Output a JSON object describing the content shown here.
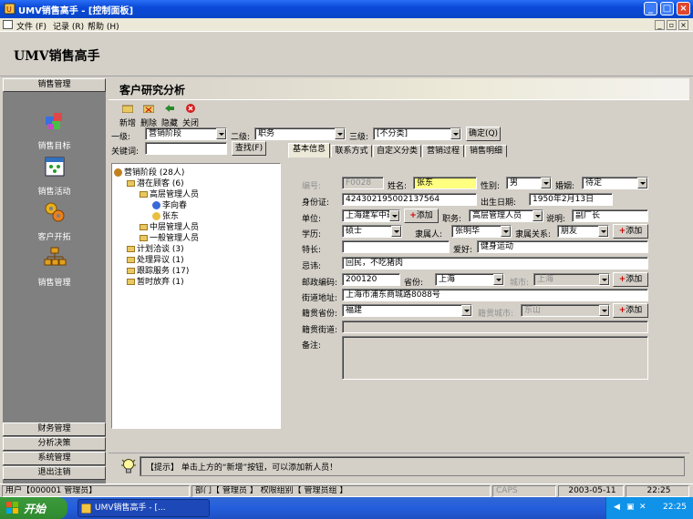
{
  "window": {
    "title": "UMV销售高手 - [控制面板]"
  },
  "menu": [
    "文件 (F)",
    "记录 (R)",
    "帮助 (H)"
  ],
  "header": {
    "app_title": "UMV销售高手"
  },
  "nav": {
    "top_section": "销售管理",
    "tiles": [
      "销售目标",
      "销售活动",
      "客户开拓",
      "销售管理"
    ],
    "bottom_sections": [
      "财务管理",
      "分析决策",
      "系统管理",
      "退出注销"
    ]
  },
  "page": {
    "title": "客户研究分析",
    "toolbar": [
      "新增",
      "删除",
      "隐藏",
      "关闭"
    ]
  },
  "filters": {
    "level1_label": "一级:",
    "level1_value": "营销阶段",
    "level2_label": "二级:",
    "level2_value": "职务",
    "level3_label": "三级:",
    "level3_value": "[不分类]",
    "confirm_label": "确定",
    "confirm_key": "(Q)",
    "keyword_label": "关键词:",
    "keyword_value": "",
    "search_label": "查找",
    "search_key": "(F)"
  },
  "tabs": [
    "基本信息",
    "联系方式",
    "自定义分类",
    "营销过程",
    "销售明细"
  ],
  "tree": [
    "营销阶段 (28人)",
    "潜在顾客 (6)",
    "高层管理人员",
    "李向春",
    "张东",
    "中层管理人员",
    "一般管理人员",
    "计划洽谈 (3)",
    "处理异议 (1)",
    "跟踪服务 (17)",
    "暂时放弃 (1)"
  ],
  "form": {
    "id_label": "编号:",
    "id_value": "F0028",
    "name_label": "姓名:",
    "name_value": "张东",
    "gender_label": "性别:",
    "gender_value": "男",
    "marital_label": "婚姻:",
    "marital_value": "待定",
    "idcard_label": "身份证:",
    "idcard_value": "424302195002137564",
    "birth_label": "出生日期:",
    "birth_value": "1950年2月13日",
    "company_label": "单位:",
    "company_value": "上海建军中药",
    "add_label": "添加",
    "title_label": "职务:",
    "title_value": "高层管理人员",
    "desc_label": "说明:",
    "desc_value": "副厂长",
    "edu_label": "学历:",
    "edu_value": "硕士",
    "owner_label": "隶属人:",
    "owner_value": "张明华",
    "relation_label": "隶属关系:",
    "relation_value": "朋友",
    "skill_label": "特长:",
    "skill_value": "",
    "hobby_label": "爱好:",
    "hobby_value": "健身运动",
    "taboo_label": "忌讳:",
    "taboo_value": "回民，不吃猪肉",
    "zip_label": "邮政编码:",
    "zip_value": "200120",
    "province_label": "省份:",
    "province_value": "上海",
    "city_label": "城市:",
    "city_value": "上海",
    "street_label": "街道地址:",
    "street_value": "上海市浦东商城路8088号",
    "native_prov_label": "籍贯省份:",
    "native_prov_value": "福建",
    "native_city_label": "籍贯城市:",
    "native_city_value": "东山",
    "native_street_label": "籍贯街道:",
    "native_street_value": "",
    "note_label": "备注:",
    "note_value": ""
  },
  "tip": {
    "text": "【提示】 单击上方的“新增”按钮，可以添加新人员！"
  },
  "status": {
    "user": "用户【000001 管理员】",
    "dept": "部门【 管理员 】 权限组别【 管理员组 】",
    "caps": "CAPS",
    "date": "2003-05-11",
    "time": "22:25"
  },
  "taskbar": {
    "start": "开始",
    "task": "UMV销售高手 - [...",
    "clock": "22:25"
  }
}
